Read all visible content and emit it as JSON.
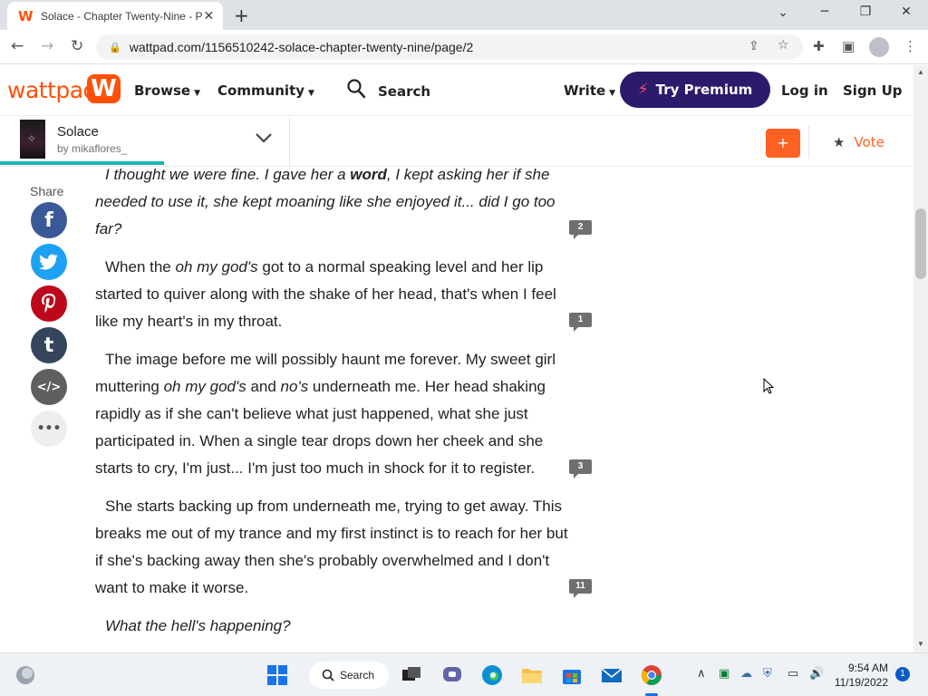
{
  "browser": {
    "tab_title": "Solace - Chapter Twenty-Nine - P",
    "url": "wattpad.com/1156510242-solace-chapter-twenty-nine/page/2"
  },
  "header": {
    "logo_text": "wattpad",
    "browse": "Browse",
    "community": "Community",
    "search": "Search",
    "write": "Write",
    "premium": "Try Premium",
    "login": "Log in",
    "signup": "Sign Up"
  },
  "story": {
    "title": "Solace",
    "author": "by mikaflores_",
    "add_label": "+",
    "vote_label": "Vote",
    "reading_progress": 0.18
  },
  "share": {
    "label": "Share",
    "facebook": "f",
    "tumblr": "t",
    "embed": "</>",
    "more": "•••"
  },
  "paragraphs": [
    {
      "segments": [
        {
          "text": "I thought we were fine. I gave her a ",
          "style": "i"
        },
        {
          "text": "word",
          "style": "bi"
        },
        {
          "text": ", I kept asking her if she needed to use it, she kept moaning like she enjoyed it... did I go too far?",
          "style": "i"
        }
      ],
      "comments": "2"
    },
    {
      "segments": [
        {
          "text": "When the ",
          "style": ""
        },
        {
          "text": "oh my god's",
          "style": "i"
        },
        {
          "text": " got to a normal speaking level and her lip started to quiver along with the shake of her head, that's when I feel like my heart's in my throat.",
          "style": ""
        }
      ],
      "comments": "1"
    },
    {
      "segments": [
        {
          "text": "The image before me will possibly haunt me forever. My sweet girl muttering ",
          "style": ""
        },
        {
          "text": "oh my god's",
          "style": "i"
        },
        {
          "text": " and ",
          "style": ""
        },
        {
          "text": "no's",
          "style": "i"
        },
        {
          "text": " underneath me. Her head shaking rapidly as if she can't believe what just happened, what she just participated in. When a single tear drops down her cheek and she starts to cry, I'm just... I'm just too much in shock for it to register.",
          "style": ""
        }
      ],
      "comments": "3"
    },
    {
      "segments": [
        {
          "text": "She starts backing up from underneath me, trying to get away. This breaks me out of my trance and my first instinct is to reach for her but if she's backing away then she's probably overwhelmed and I don't want to make it worse.",
          "style": ""
        }
      ],
      "comments": "11"
    },
    {
      "segments": [
        {
          "text": "What the hell's happening?",
          "style": "i"
        }
      ],
      "comments": ""
    }
  ],
  "taskbar": {
    "search": "Search",
    "time": "9:54 AM",
    "date": "11/19/2022",
    "notifications": "1"
  },
  "colors": {
    "brand": "#ff500a",
    "premium_bg": "#2c1b6b",
    "progress": "#17b6b2",
    "facebook": "#3b5998",
    "twitter": "#1da1f2",
    "pinterest": "#bd081c",
    "tumblr": "#35465c",
    "embed": "#5f5f5f",
    "more": "#eeeeee"
  }
}
